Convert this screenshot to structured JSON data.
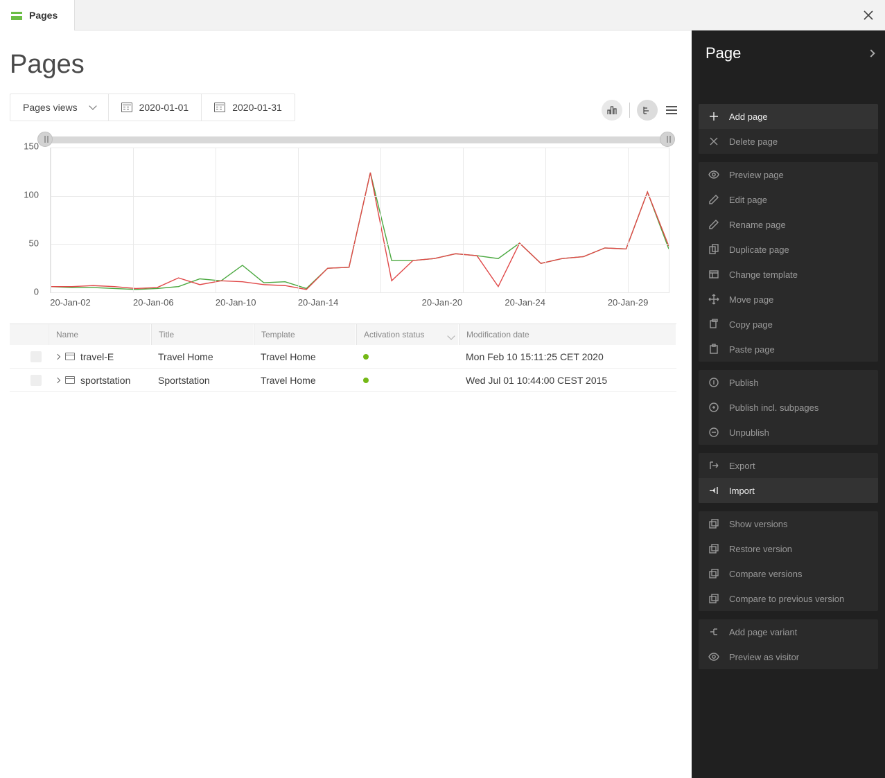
{
  "tab": {
    "label": "Pages"
  },
  "page_title": "Pages",
  "filters": {
    "metric": "Pages views",
    "date_from": "2020-01-01",
    "date_to": "2020-01-31"
  },
  "chart_data": {
    "type": "line",
    "ylim": [
      0,
      150
    ],
    "yticks": [
      0,
      50,
      100,
      150
    ],
    "x_labels": [
      "20-Jan-02",
      "20-Jan-06",
      "20-Jan-10",
      "20-Jan-14",
      "20-Jan-20",
      "20-Jan-24",
      "20-Jan-29"
    ],
    "x_label_positions_frac": [
      0.033,
      0.167,
      0.3,
      0.433,
      0.633,
      0.767,
      0.933
    ],
    "x_grid_frac": [
      0.0,
      0.1333,
      0.2666,
      0.4,
      0.5333,
      0.6666,
      0.8,
      0.9333
    ],
    "series": [
      {
        "name": "green",
        "color": "#4aa83f",
        "x": [
          0,
          1,
          2,
          3,
          4,
          5,
          6,
          7,
          8,
          9,
          10,
          11,
          12,
          13,
          14,
          15,
          16,
          17,
          18,
          19,
          20,
          21,
          22,
          23,
          24,
          25,
          26,
          27,
          28,
          29
        ],
        "y": [
          6,
          5,
          5,
          4,
          3,
          4,
          6,
          14,
          12,
          28,
          10,
          11,
          4,
          25,
          26,
          124,
          33,
          33,
          35,
          40,
          38,
          35,
          51,
          30,
          35,
          37,
          46,
          45,
          104,
          45
        ]
      },
      {
        "name": "red",
        "color": "#e04848",
        "x": [
          0,
          1,
          2,
          3,
          4,
          5,
          6,
          7,
          8,
          9,
          10,
          11,
          12,
          13,
          14,
          15,
          16,
          17,
          18,
          19,
          20,
          21,
          22,
          23,
          24,
          25,
          26,
          27,
          28,
          29
        ],
        "y": [
          6,
          6,
          7,
          6,
          4,
          5,
          15,
          8,
          12,
          11,
          8,
          7,
          3,
          25,
          26,
          124,
          12,
          33,
          35,
          40,
          38,
          6,
          51,
          30,
          35,
          37,
          46,
          45,
          104,
          48
        ]
      }
    ]
  },
  "table": {
    "columns": [
      "Name",
      "Title",
      "Template",
      "Activation status",
      "Modification date"
    ],
    "rows": [
      {
        "name": "travel-E",
        "title": "Travel Home",
        "template": "Travel Home",
        "status": "active",
        "date": "Mon Feb 10 15:11:25 CET 2020"
      },
      {
        "name": "sportstation",
        "title": "Sportstation",
        "template": "Travel Home",
        "status": "active",
        "date": "Wed Jul 01 10:44:00 CEST 2015"
      }
    ]
  },
  "sidebar": {
    "title": "Page",
    "groups": [
      [
        {
          "label": "Add page",
          "icon": "plus",
          "enabled": true
        },
        {
          "label": "Delete page",
          "icon": "x",
          "enabled": false
        }
      ],
      [
        {
          "label": "Preview page",
          "icon": "eye",
          "enabled": false
        },
        {
          "label": "Edit page",
          "icon": "pencil",
          "enabled": false
        },
        {
          "label": "Rename page",
          "icon": "pencil",
          "enabled": false
        },
        {
          "label": "Duplicate page",
          "icon": "dup",
          "enabled": false
        },
        {
          "label": "Change template",
          "icon": "template",
          "enabled": false
        },
        {
          "label": "Move page",
          "icon": "move",
          "enabled": false
        },
        {
          "label": "Copy page",
          "icon": "copy",
          "enabled": false
        },
        {
          "label": "Paste page",
          "icon": "paste",
          "enabled": false
        }
      ],
      [
        {
          "label": "Publish",
          "icon": "publish",
          "enabled": false
        },
        {
          "label": "Publish incl. subpages",
          "icon": "publish-tree",
          "enabled": false
        },
        {
          "label": "Unpublish",
          "icon": "unpublish",
          "enabled": false
        }
      ],
      [
        {
          "label": "Export",
          "icon": "export",
          "enabled": false
        },
        {
          "label": "Import",
          "icon": "import",
          "enabled": true
        }
      ],
      [
        {
          "label": "Show versions",
          "icon": "versions",
          "enabled": false
        },
        {
          "label": "Restore version",
          "icon": "versions",
          "enabled": false
        },
        {
          "label": "Compare versions",
          "icon": "versions",
          "enabled": false
        },
        {
          "label": "Compare to previous version",
          "icon": "versions",
          "enabled": false
        }
      ],
      [
        {
          "label": "Add page variant",
          "icon": "variant",
          "enabled": false
        },
        {
          "label": "Preview as visitor",
          "icon": "eye",
          "enabled": false
        }
      ]
    ]
  }
}
